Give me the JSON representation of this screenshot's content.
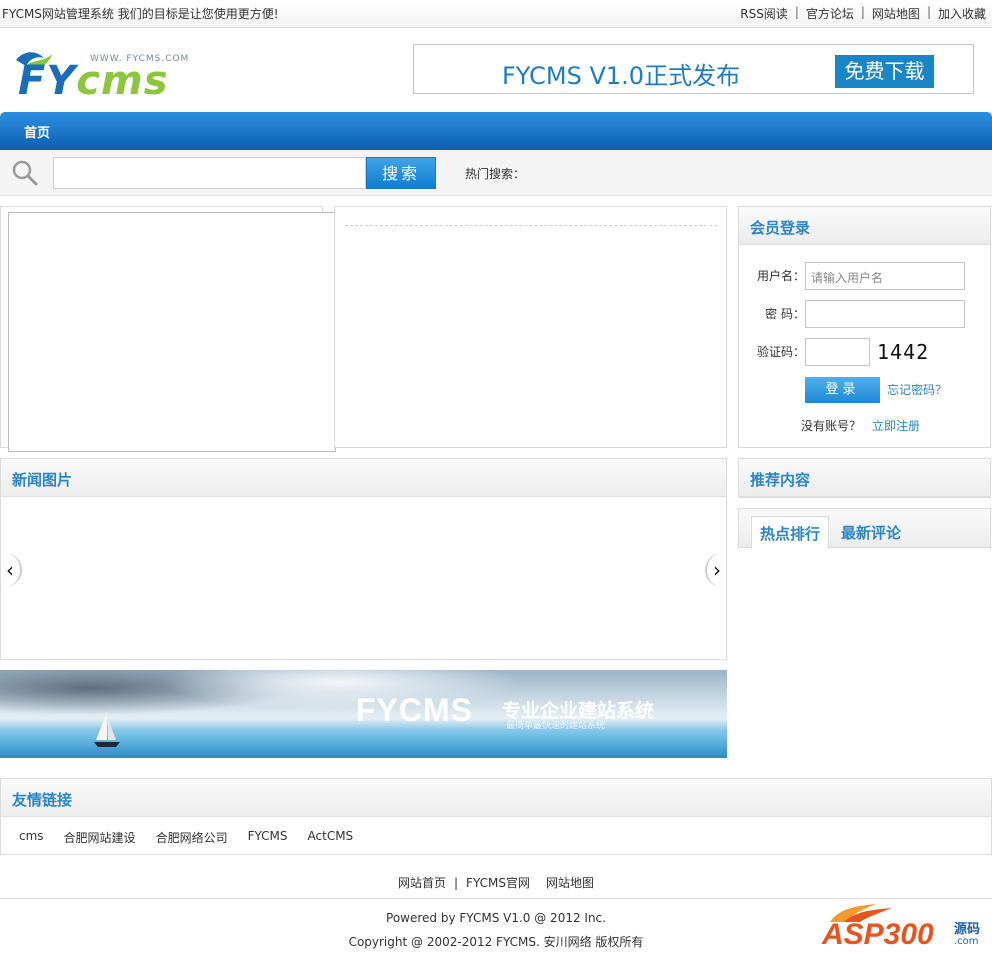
{
  "topbar": {
    "slogan": "FYCMS网站管理系统 我们的目标是让您使用更方便!",
    "links": [
      "RSS阅读",
      "官方论坛",
      "网站地图",
      "加入收藏"
    ],
    "separator": "|"
  },
  "logo": {
    "site": "WWW. FYCMS.COM",
    "word_a": "FY",
    "word_b": "cms"
  },
  "release_banner": {
    "title": "FYCMS V1.0正式发布",
    "download_label": "免费下载"
  },
  "nav": {
    "home_label": "首页"
  },
  "search": {
    "button_label": "搜索",
    "hot_label": "热门搜索："
  },
  "login": {
    "title": "会员登录",
    "username_label": "用户名：",
    "username_placeholder": "请输入用户名",
    "password_label": "密  码：",
    "captcha_label": "验证码：",
    "captcha_value": "1442",
    "login_button": "登录",
    "forgot_link": "忘记密码？",
    "no_account": "没有账号？",
    "register_link": "立即注册"
  },
  "picnews": {
    "title": "新闻图片",
    "arrow_left": "‹",
    "arrow_right": "›"
  },
  "recommend": {
    "title": "推荐内容",
    "tabs": [
      "热点排行",
      "最新评论"
    ]
  },
  "ad_banner": {
    "brand": "FYCMS",
    "tagline": "专业企业建站系统",
    "subline": "最简单最快速的建站系统"
  },
  "friends": {
    "title": "友情链接",
    "links": [
      "cms",
      "合肥网站建设",
      "合肥网络公司",
      "FYCMS",
      "ActCMS"
    ]
  },
  "footer": {
    "nav": [
      "网站首页",
      "FYCMS官网",
      "网站地图"
    ],
    "separator": "|",
    "powered": "Powered by FYCMS V1.0 @ 2012 Inc.",
    "copyright": "Copyright @ 2002-2012 FYCMS. 安川网络 版权所有"
  },
  "watermark": {
    "main": "ASP300",
    "side_top": "源码",
    "side_bottom": ".com"
  },
  "colors": {
    "accent": "#2c86c5",
    "nav": "#1a6fc4",
    "logo_green": "#8cc63f"
  },
  "icons": [
    "search-icon",
    "arrow-left-icon",
    "arrow-right-icon",
    "sailboat-icon"
  ]
}
